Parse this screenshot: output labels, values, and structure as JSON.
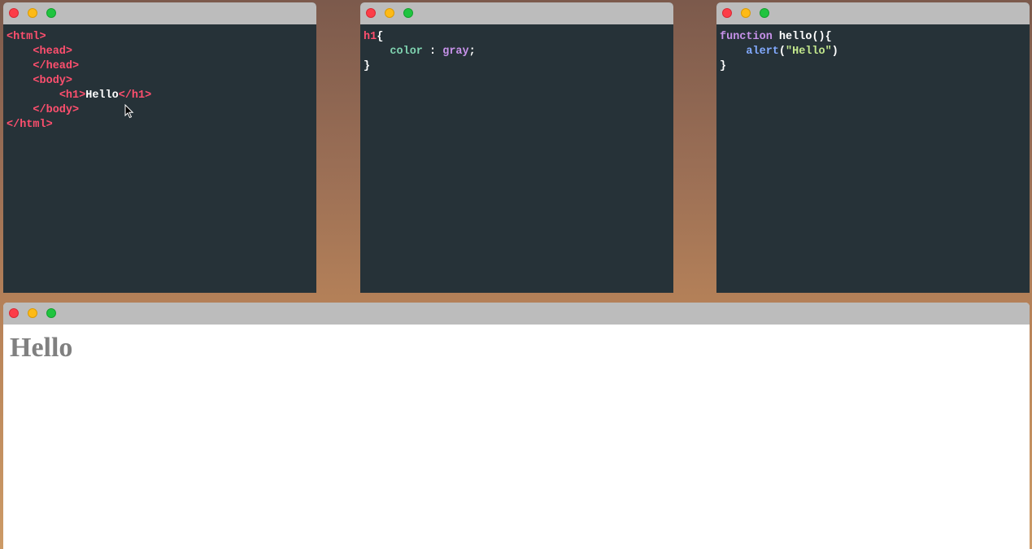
{
  "editors": {
    "html": {
      "lines": {
        "l1": {
          "open": "<html>"
        },
        "l2": {
          "open": "<head>"
        },
        "l3": {
          "open": "</head>"
        },
        "l4": {
          "open": "<body>"
        },
        "l5": {
          "open": "<h1>",
          "text": "Hello",
          "close": "</h1>"
        },
        "l6": {
          "open": "</body>"
        },
        "l7": {
          "open": "</html>"
        }
      }
    },
    "css": {
      "selector": "h1",
      "open_brace": "{",
      "property": "color",
      "colon": " : ",
      "value": "gray",
      "semicolon": ";",
      "close_brace": "}"
    },
    "js": {
      "keyword": "function",
      "function_name": "hello",
      "signature_punct": "(){",
      "call_name": "alert",
      "call_open": "(",
      "call_arg": "\"Hello\"",
      "call_close": ")",
      "close_brace": "}"
    }
  },
  "preview": {
    "heading": "Hello"
  },
  "colors": {
    "editor_bg": "#263238",
    "titlebar": "#bcbcbc",
    "tag": "#ff4f6e",
    "css_property": "#7fd3b0",
    "css_value": "#c792ea",
    "js_keyword": "#c792ea",
    "js_call": "#82aaff",
    "js_string": "#c3e88d",
    "preview_heading": "#808080"
  }
}
